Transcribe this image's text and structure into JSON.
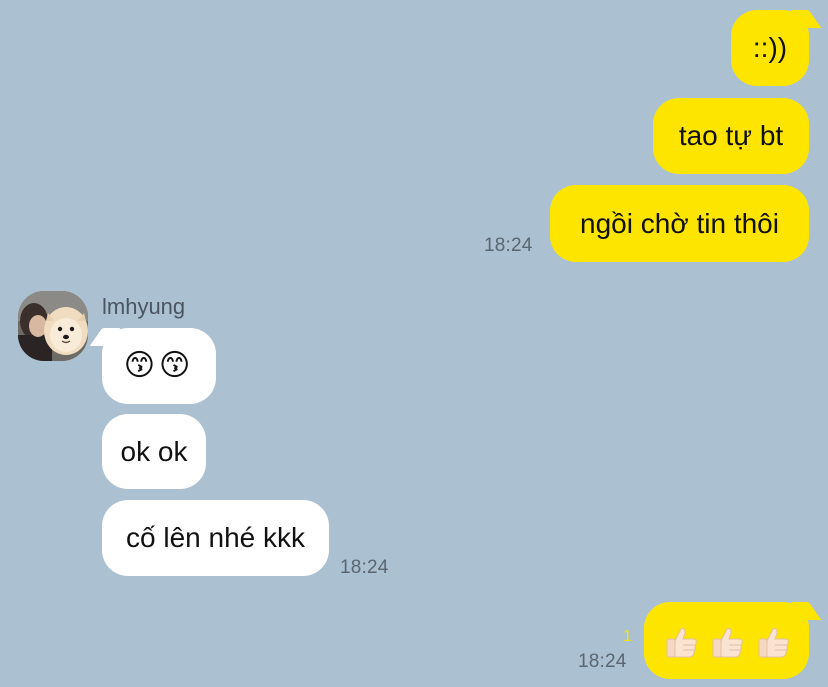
{
  "messages": {
    "m1": "::))",
    "m2": "tao tự bt",
    "m3": "ngồi chờ tin thôi",
    "m3_time": "18:24",
    "sender_name": "lmhyung",
    "r1": "😙😙",
    "r2": "ok ok",
    "r3": "cố lên nhé kkk",
    "r3_time": "18:24",
    "last_unread": "1",
    "last_time": "18:24",
    "last_emoji_count": 3
  },
  "colors": {
    "background": "#abc1d1",
    "my_bubble": "#fee500",
    "their_bubble": "#ffffff",
    "timestamp": "#5b6670",
    "unread": "#f6e200"
  },
  "icons": {
    "avatar": "avatar-dog-photo",
    "thumbs": "thumbs-up-icon",
    "kiss": "kissing-face-icon"
  }
}
